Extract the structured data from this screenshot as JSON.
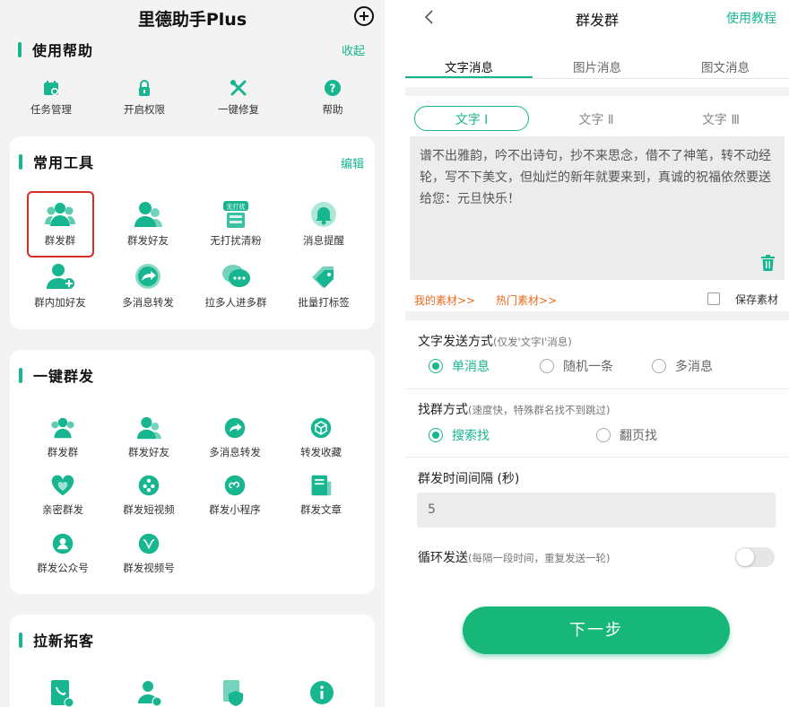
{
  "left": {
    "app_title": "里德助手Plus",
    "help": {
      "title": "使用帮助",
      "action": "收起",
      "items": [
        {
          "label": "任务管理",
          "icon": "calendar-gear-icon"
        },
        {
          "label": "开启权限",
          "icon": "lock-icon"
        },
        {
          "label": "一键修复",
          "icon": "wrench-icon"
        },
        {
          "label": "帮助",
          "icon": "question-icon"
        }
      ]
    },
    "common_tools": {
      "title": "常用工具",
      "action": "编辑",
      "items": [
        {
          "label": "群发群",
          "icon": "group-icon"
        },
        {
          "label": "群发好友",
          "icon": "users-icon"
        },
        {
          "label": "无打扰清粉",
          "icon": "no-disturb-icon",
          "badge": "无打扰"
        },
        {
          "label": "消息提醒",
          "icon": "bell-icon"
        },
        {
          "label": "群内加好友",
          "icon": "user-add-icon"
        },
        {
          "label": "多消息转发",
          "icon": "forward-icon"
        },
        {
          "label": "拉多人进多群",
          "icon": "chat-bubbles-icon"
        },
        {
          "label": "批量打标签",
          "icon": "tag-icon"
        }
      ]
    },
    "one_click": {
      "title": "一键群发",
      "items": [
        {
          "label": "群发群",
          "icon": "group-icon"
        },
        {
          "label": "群发好友",
          "icon": "users-icon"
        },
        {
          "label": "多消息转发",
          "icon": "forward-icon"
        },
        {
          "label": "转发收藏",
          "icon": "cube-icon"
        },
        {
          "label": "亲密群发",
          "icon": "heart-chat-icon"
        },
        {
          "label": "群发短视频",
          "icon": "film-icon"
        },
        {
          "label": "群发小程序",
          "icon": "mini-program-icon"
        },
        {
          "label": "群发文章",
          "icon": "article-icon"
        },
        {
          "label": "群发公众号",
          "icon": "official-account-icon"
        },
        {
          "label": "群发视频号",
          "icon": "video-channel-icon"
        }
      ]
    },
    "acquire": {
      "title": "拉新拓客",
      "icons": [
        "contact-book-icon",
        "user-add-icon",
        "shield-file-icon",
        "info-icon"
      ]
    }
  },
  "right": {
    "title": "群发群",
    "tutorial": "使用教程",
    "tabs": [
      "文字消息",
      "图片消息",
      "图文消息"
    ],
    "subtabs": [
      "文字 Ⅰ",
      "文字 Ⅱ",
      "文字 Ⅲ"
    ],
    "message": "谱不出雅韵，吟不出诗句，抄不来思念，借不了神笔，转不动经轮，写不下美文，但灿烂的新年就要来到，真诚的祝福依然要送给您：元旦快乐！",
    "my_material": "我的素材>>",
    "hot_material": "热门素材>>",
    "save_material": "保存素材",
    "send_mode": {
      "label": "文字发送方式",
      "note": "(仅发'文字Ⅰ'消息)",
      "options": [
        "单消息",
        "随机一条",
        "多消息"
      ],
      "selected": "单消息"
    },
    "find_mode": {
      "label": "找群方式",
      "note": "(速度快，特殊群名找不到跳过)",
      "options": [
        "搜索找",
        "翻页找"
      ],
      "selected": "搜索找"
    },
    "interval": {
      "label": "群发时间间隔 (秒)",
      "value": "5"
    },
    "loop": {
      "label": "循环发送",
      "note": "(每隔一段时间，重复发送一轮)",
      "enabled": false
    },
    "next_button": "下一步"
  },
  "colors": {
    "accent": "#17b690",
    "button": "#17b679",
    "link_orange": "#ea6a1e",
    "highlight": "#d32f24"
  }
}
